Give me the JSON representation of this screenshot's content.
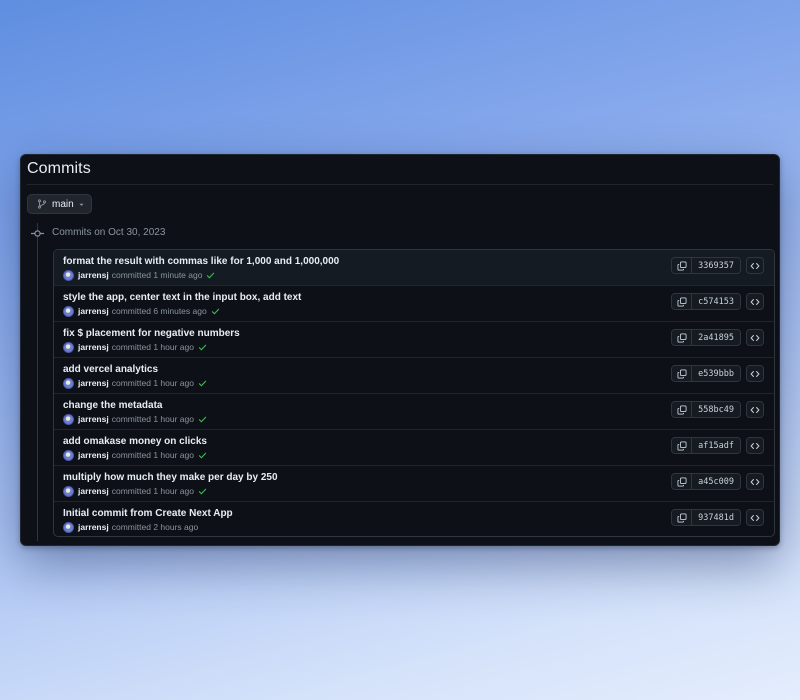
{
  "page": {
    "title": "Commits"
  },
  "branch": {
    "name": "main"
  },
  "group": {
    "date_label": "Commits on Oct 30, 2023"
  },
  "commits": [
    {
      "message": "format the result with commas like for 1,000 and 1,000,000",
      "author": "jarrensj",
      "verb": "committed",
      "time": "1 minute ago",
      "verified": true,
      "sha": "3369357"
    },
    {
      "message": "style the app, center text in the input box, add text",
      "author": "jarrensj",
      "verb": "committed",
      "time": "6 minutes ago",
      "verified": true,
      "sha": "c574153"
    },
    {
      "message": "fix $ placement for negative numbers",
      "author": "jarrensj",
      "verb": "committed",
      "time": "1 hour ago",
      "verified": true,
      "sha": "2a41895"
    },
    {
      "message": "add vercel analytics",
      "author": "jarrensj",
      "verb": "committed",
      "time": "1 hour ago",
      "verified": true,
      "sha": "e539bbb"
    },
    {
      "message": "change the metadata",
      "author": "jarrensj",
      "verb": "committed",
      "time": "1 hour ago",
      "verified": true,
      "sha": "558bc49"
    },
    {
      "message": "add omakase money on clicks",
      "author": "jarrensj",
      "verb": "committed",
      "time": "1 hour ago",
      "verified": true,
      "sha": "af15adf"
    },
    {
      "message": "multiply how much they make per day by 250",
      "author": "jarrensj",
      "verb": "committed",
      "time": "1 hour ago",
      "verified": true,
      "sha": "a45c009"
    },
    {
      "message": "Initial commit from Create Next App",
      "author": "jarrensj",
      "verb": "committed",
      "time": "2 hours ago",
      "verified": false,
      "sha": "937481d"
    }
  ],
  "icons": {
    "branch": "git-branch-icon",
    "caret": "caret-down-icon",
    "node": "git-commit-icon",
    "check": "check-icon",
    "copy": "copy-icon",
    "code": "code-icon"
  },
  "colors": {
    "background": "#0d1117",
    "text": "#e6edf3",
    "muted": "#8b949e",
    "border": "#30363d",
    "success": "#3fb950"
  }
}
